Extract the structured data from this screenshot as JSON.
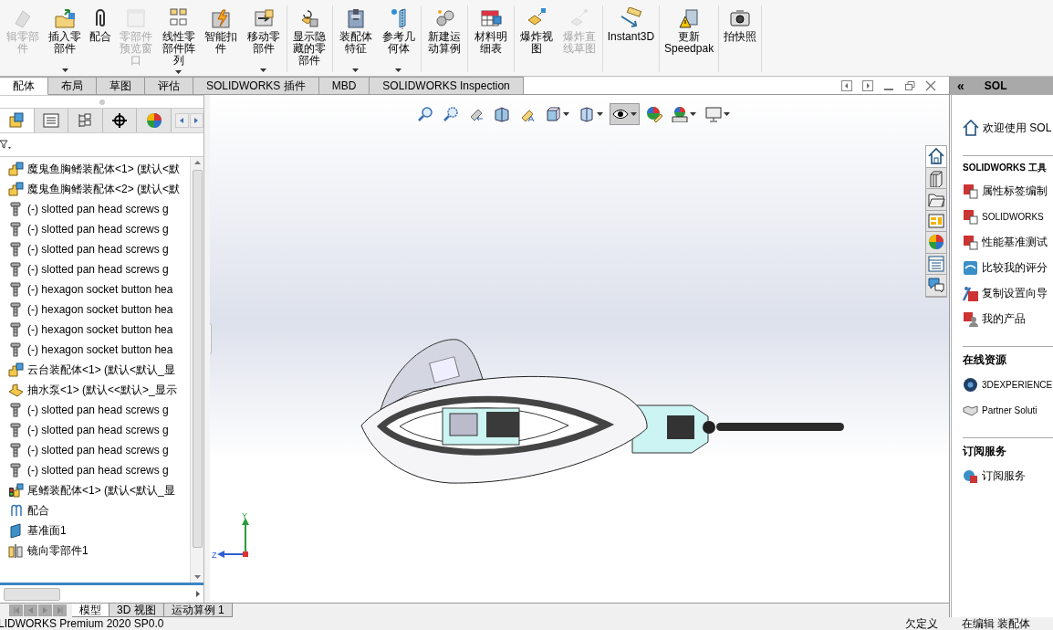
{
  "ribbon": {
    "groups": [
      {
        "buttons": [
          {
            "label": "辑零部件",
            "disabled": true,
            "dropdown": false
          },
          {
            "label": "插入零部件",
            "disabled": false,
            "dropdown": true
          },
          {
            "label": "配合",
            "disabled": false,
            "dropdown": false
          },
          {
            "label": "零部件预览窗口",
            "disabled": true,
            "dropdown": false
          },
          {
            "label": "线性零部件阵列",
            "disabled": false,
            "dropdown": true
          },
          {
            "label": "智能扣件",
            "disabled": false,
            "dropdown": false
          },
          {
            "label": "移动零部件",
            "disabled": false,
            "dropdown": true
          }
        ]
      },
      {
        "buttons": [
          {
            "label": "显示隐藏的零部件",
            "disabled": false,
            "dropdown": false
          }
        ]
      },
      {
        "buttons": [
          {
            "label": "装配体特征",
            "disabled": false,
            "dropdown": true
          },
          {
            "label": "参考几何体",
            "disabled": false,
            "dropdown": true
          }
        ]
      },
      {
        "buttons": [
          {
            "label": "新建运动算例",
            "disabled": false,
            "dropdown": false
          }
        ]
      },
      {
        "buttons": [
          {
            "label": "材料明细表",
            "disabled": false,
            "dropdown": false
          }
        ]
      },
      {
        "buttons": [
          {
            "label": "爆炸视图",
            "disabled": false,
            "dropdown": false
          },
          {
            "label": "爆炸直线草图",
            "disabled": true,
            "dropdown": false
          }
        ]
      },
      {
        "buttons": [
          {
            "label": "Instant3D",
            "disabled": false,
            "dropdown": false
          }
        ]
      },
      {
        "buttons": [
          {
            "label": "更新Speedpak",
            "disabled": false,
            "dropdown": false
          }
        ]
      },
      {
        "buttons": [
          {
            "label": "拍快照",
            "disabled": false,
            "dropdown": false
          }
        ]
      }
    ]
  },
  "tabs": [
    {
      "label": "配体",
      "selected": true
    },
    {
      "label": "布局",
      "selected": false
    },
    {
      "label": "草图",
      "selected": false
    },
    {
      "label": "评估",
      "selected": false
    },
    {
      "label": "SOLIDWORKS 插件",
      "selected": false
    },
    {
      "label": "MBD",
      "selected": false
    },
    {
      "label": "SOLIDWORKS Inspection",
      "selected": false
    }
  ],
  "panel_tabs": [
    {
      "selected": true
    },
    {
      "selected": false
    },
    {
      "selected": false
    },
    {
      "selected": false
    },
    {
      "selected": false
    }
  ],
  "tree": {
    "items": [
      {
        "kind": "assembly",
        "label": "魔鬼鱼胸鳍装配体<1> (默认<默"
      },
      {
        "kind": "assembly",
        "label": "魔鬼鱼胸鳍装配体<2> (默认<默"
      },
      {
        "kind": "screw",
        "label": "(-) slotted pan head screws g"
      },
      {
        "kind": "screw",
        "label": "(-) slotted pan head screws g"
      },
      {
        "kind": "screw",
        "label": "(-) slotted pan head screws g"
      },
      {
        "kind": "screw",
        "label": "(-) slotted pan head screws g"
      },
      {
        "kind": "screw",
        "label": "(-) hexagon socket button hea"
      },
      {
        "kind": "screw",
        "label": "(-) hexagon socket button hea"
      },
      {
        "kind": "screw",
        "label": "(-) hexagon socket button hea"
      },
      {
        "kind": "screw",
        "label": "(-) hexagon socket button hea"
      },
      {
        "kind": "assembly",
        "label": "云台装配体<1> (默认<默认_显"
      },
      {
        "kind": "part",
        "label": "抽水泵<1> (默认<<默认>_显示"
      },
      {
        "kind": "screw",
        "label": "(-) slotted pan head screws g"
      },
      {
        "kind": "screw",
        "label": "(-) slotted pan head screws g"
      },
      {
        "kind": "screw",
        "label": "(-) slotted pan head screws g"
      },
      {
        "kind": "screw",
        "label": "(-) slotted pan head screws g"
      },
      {
        "kind": "flagged",
        "label": "尾鳍装配体<1> (默认<默认_显"
      },
      {
        "kind": "mates",
        "label": "配合"
      },
      {
        "kind": "plane",
        "label": "基准面1"
      },
      {
        "kind": "mirror",
        "label": "镜向零部件1"
      }
    ]
  },
  "view_toolbar": [
    {
      "selected": false,
      "dropdown": false
    },
    {
      "selected": false,
      "dropdown": false
    },
    {
      "selected": false,
      "dropdown": false
    },
    {
      "selected": false,
      "dropdown": false
    },
    {
      "selected": false,
      "dropdown": false
    },
    {
      "selected": false,
      "dropdown": true
    },
    {
      "selected": false,
      "dropdown": true
    },
    {
      "selected": true,
      "dropdown": true
    },
    {
      "selected": false,
      "dropdown": false
    },
    {
      "selected": false,
      "dropdown": true
    },
    {
      "selected": false,
      "dropdown": true
    }
  ],
  "side_tabs": [
    {
      "selected": true
    },
    {
      "selected": false
    },
    {
      "selected": false
    },
    {
      "selected": false
    },
    {
      "selected": false
    },
    {
      "selected": false
    },
    {
      "selected": false
    }
  ],
  "triad": {
    "y_label": "Y",
    "z_label": "Z"
  },
  "task_pane": {
    "collapse": "«",
    "title": "SOL",
    "welcome": "欢迎使用 SOL",
    "sections": [
      {
        "title": "SOLIDWORKS 工具",
        "items": [
          "属性标签编制",
          "SOLIDWORKS",
          "性能基准测试",
          "比较我的评分",
          "复制设置向导",
          "我的产品"
        ]
      },
      {
        "title": "在线资源",
        "items": [
          "3DEXPERIENCE",
          "Partner Soluti"
        ]
      },
      {
        "title": "订阅服务",
        "items": [
          "订阅服务"
        ]
      }
    ]
  },
  "bottom_tabs": [
    {
      "label": "模型",
      "selected": true
    },
    {
      "label": "3D 视图",
      "selected": false
    },
    {
      "label": "运动算例 1",
      "selected": false
    }
  ],
  "status_bar": {
    "product": "LIDWORKS Premium 2020 SP0.0",
    "state": "欠定义",
    "mode": "在编辑 装配体"
  }
}
